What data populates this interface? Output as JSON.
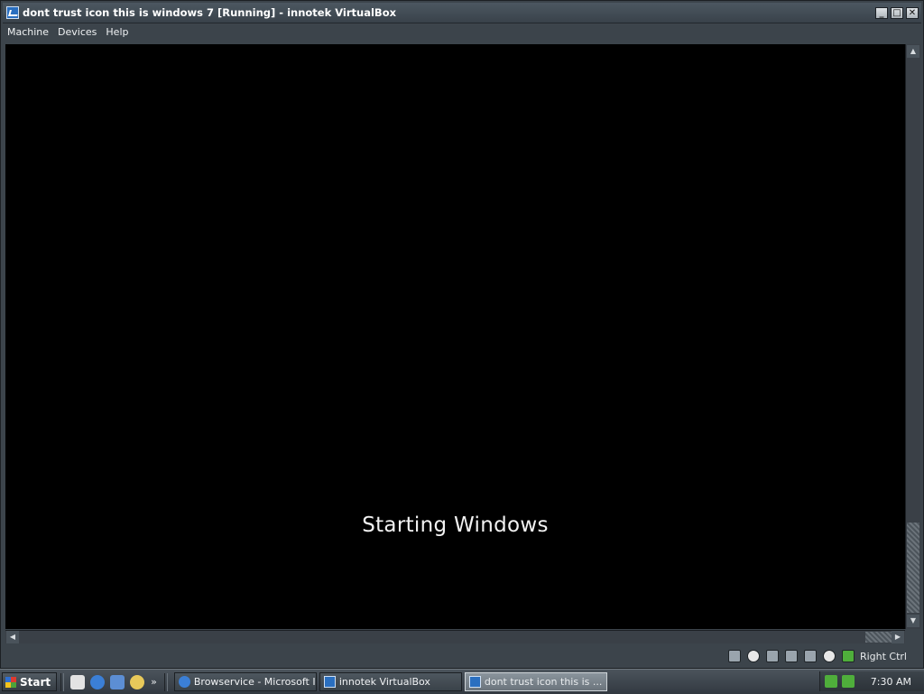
{
  "window": {
    "title": "dont trust icon this is windows 7 [Running] - innotek VirtualBox",
    "buttons": {
      "minimize": "_",
      "maximize": "□",
      "close": "✕"
    }
  },
  "menu": {
    "items": [
      "Machine",
      "Devices",
      "Help"
    ]
  },
  "vm_screen": {
    "boot_message": "Starting Windows"
  },
  "scrollbars": {
    "up_arrow": "▲",
    "down_arrow": "▼",
    "left_arrow": "◀",
    "right_arrow": "▶"
  },
  "status_bar": {
    "icons": [
      "hard-disk-icon",
      "cd-dvd-icon",
      "floppy-icon",
      "network-icon",
      "shared-folders-icon",
      "mouse-integration-icon",
      "host-key-icon"
    ],
    "host_key_label": "Right Ctrl"
  },
  "taskbar": {
    "start_label": "Start",
    "quick_launch_icons": [
      "documents-icon",
      "internet-explorer-icon",
      "email-icon",
      "search-icon"
    ],
    "overflow_chevron": "»",
    "tasks": [
      {
        "label": "Browservice - Microsoft I...",
        "icon": "internet-explorer-icon",
        "active": false
      },
      {
        "label": "innotek VirtualBox",
        "icon": "virtualbox-icon",
        "active": false
      },
      {
        "label": "dont trust icon this is ...",
        "icon": "virtualbox-icon",
        "active": true
      }
    ],
    "clock": "7:30 AM"
  }
}
